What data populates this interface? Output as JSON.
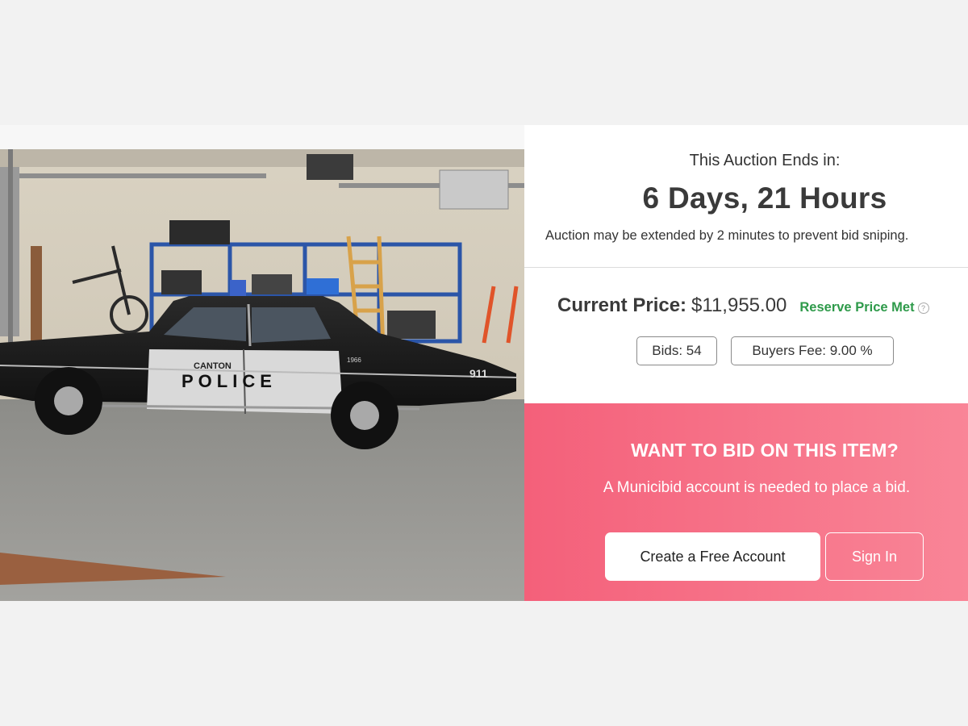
{
  "photo": {
    "door_text": "CANTON",
    "side_text": "POLICE",
    "fender_number": "911",
    "fender_year": "1966"
  },
  "auction": {
    "ends_label": "This Auction Ends in:",
    "countdown": "6 Days, 21 Hours",
    "extend_note": "Auction may be extended by 2 minutes to prevent bid sniping.",
    "current_price_label": "Current Price:",
    "current_price_value": "$11,955.00",
    "reserve_status": "Reserve Price Met",
    "bids": "Bids: 54",
    "buyers_fee": "Buyers Fee: 9.00 %"
  },
  "cta": {
    "title": "WANT TO BID ON THIS ITEM?",
    "subtitle": "A Municibid account is needed to place a bid.",
    "create_account_label": "Create a Free Account",
    "sign_in_label": "Sign In"
  },
  "colors": {
    "cta_gradient_start": "#f4607a",
    "cta_gradient_end": "#f98597",
    "reserve_green": "#2e9a4a"
  },
  "icons": [
    "info-icon"
  ]
}
